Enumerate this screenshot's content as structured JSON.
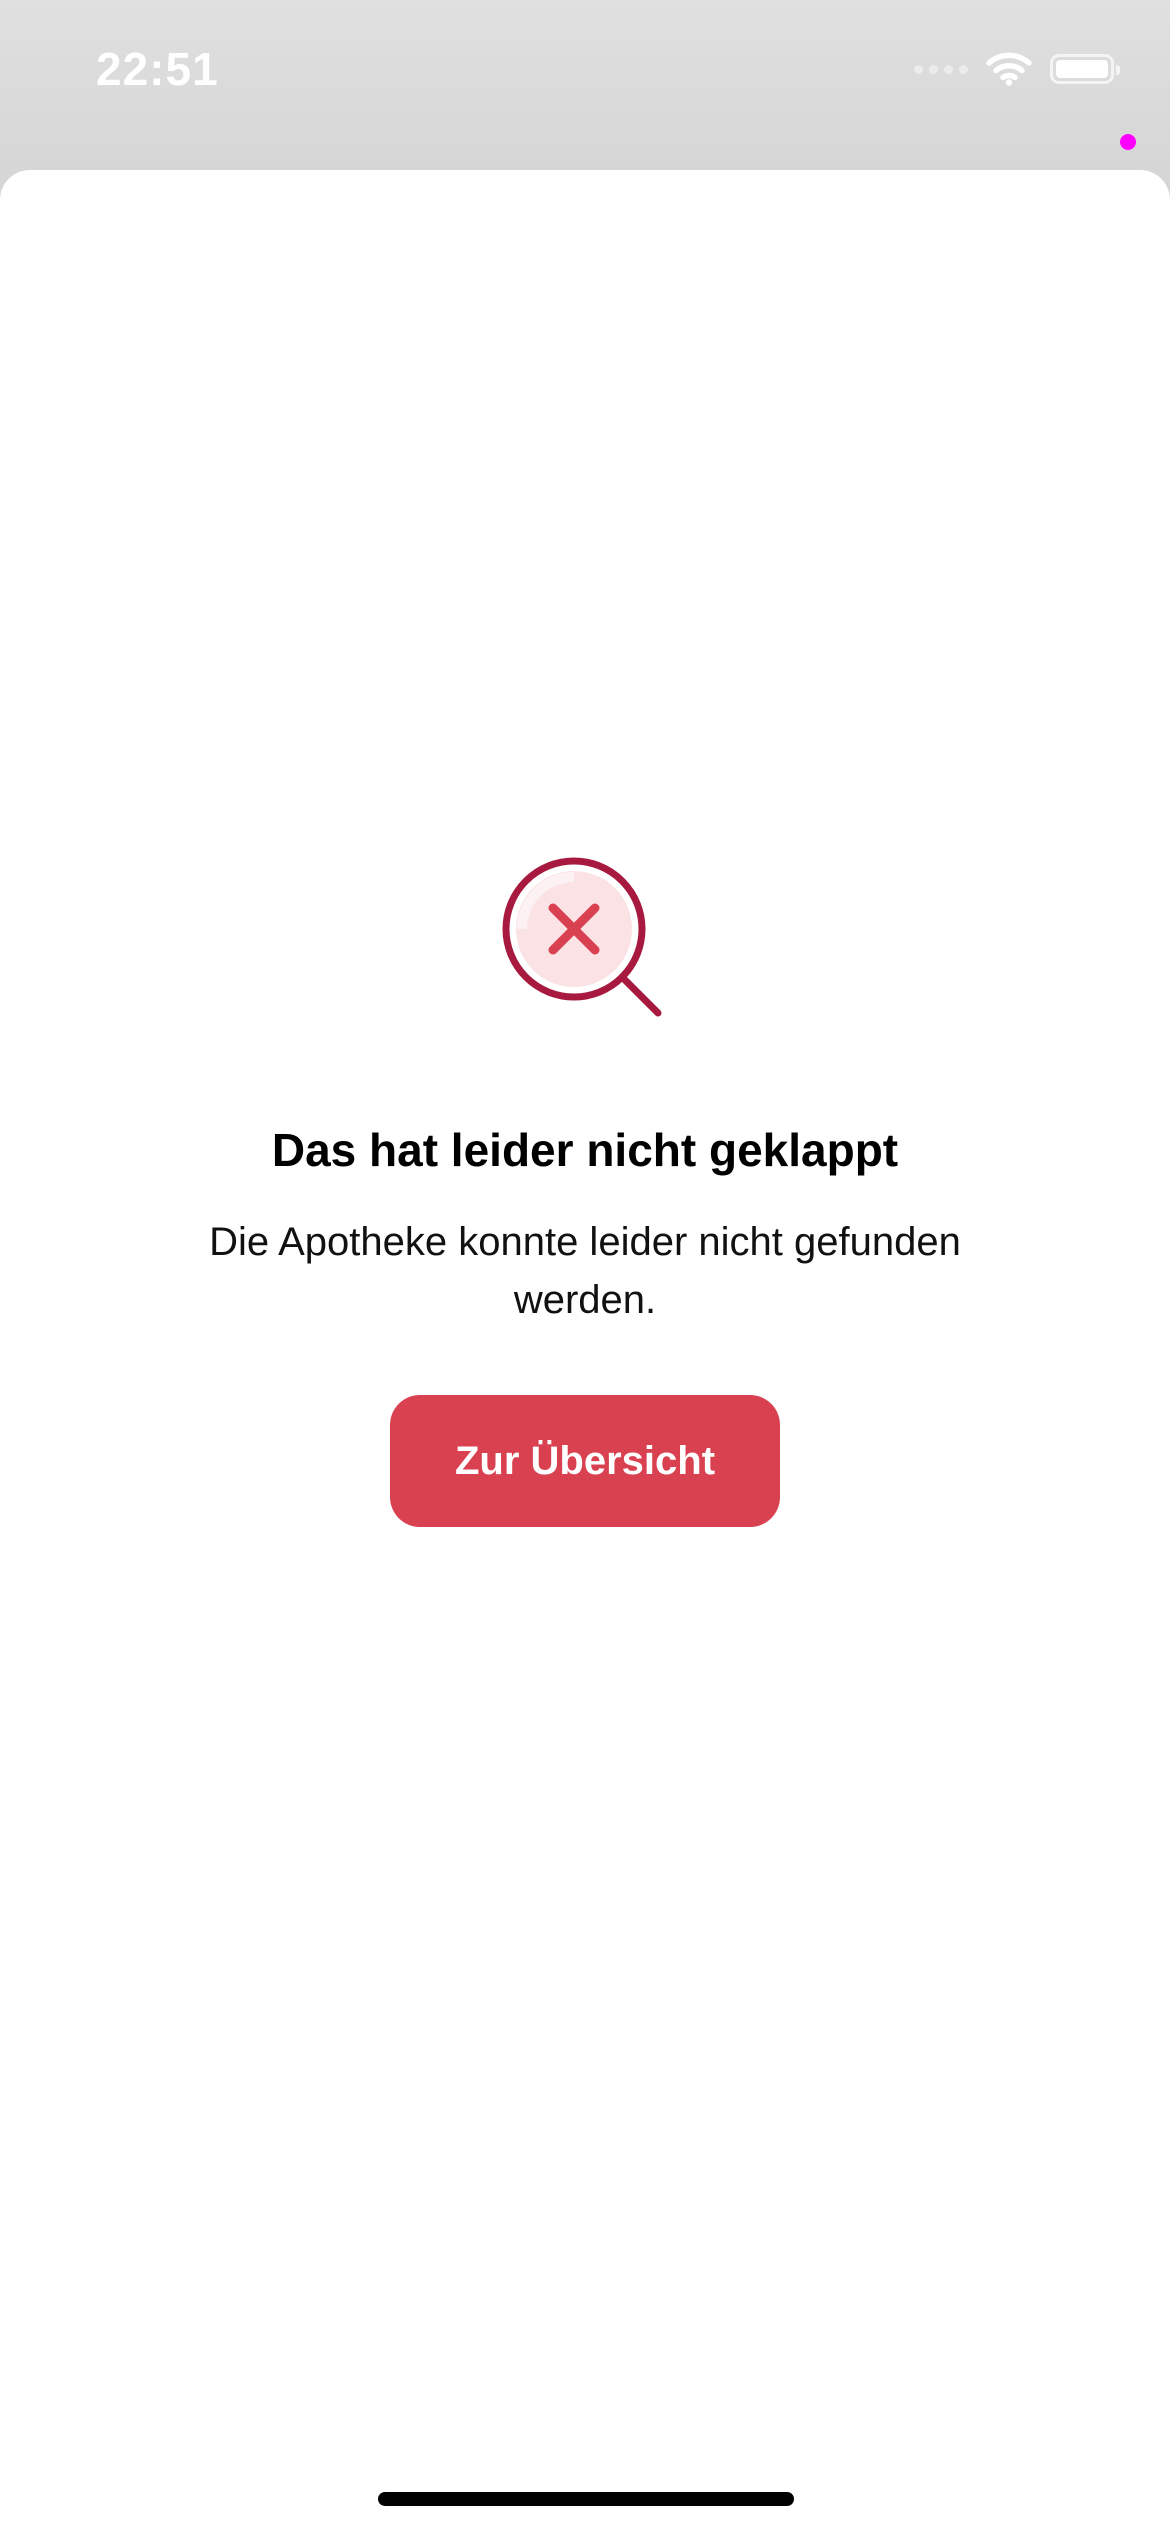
{
  "status_bar": {
    "time": "22:51"
  },
  "dialog": {
    "illustration_icon": "search-not-found-icon",
    "title": "Das hat leider nicht geklappt",
    "message": "Die Apotheke konnte leider nicht gefunden werden.",
    "button_label": "Zur Übersicht"
  },
  "colors": {
    "accent": "#d94050",
    "icon_dark": "#a8193f",
    "icon_light": "#fbe2e5",
    "recording_dot": "#ff00ff"
  }
}
